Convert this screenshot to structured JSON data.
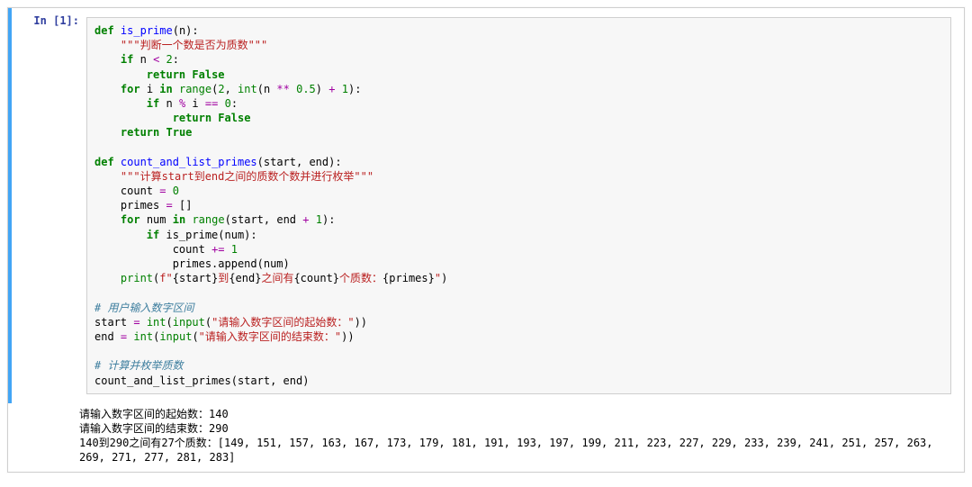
{
  "cell": {
    "prompt": "In [1]:",
    "code": {
      "l01": {
        "def": "def",
        "fn": "is_prime",
        "rest": "(n):"
      },
      "l02": {
        "doc": "\"\"\"判断一个数是否为质数\"\"\""
      },
      "l03": {
        "kw_if": "if",
        "n": "n",
        "lt": "<",
        "two": "2",
        "colon": ":"
      },
      "l04": {
        "ret": "return",
        "false": "False"
      },
      "l05": {
        "for": "for",
        "i": "i",
        "in": "in",
        "range": "range",
        "two": "2",
        "int": "int",
        "n": "n",
        "star": "**",
        "half": "0.5",
        "plus": "+",
        "one": "1",
        "colon": ":"
      },
      "l06": {
        "if": "if",
        "n": "n",
        "mod": "%",
        "i": "i",
        "eq": "==",
        "zero": "0",
        "colon": ":"
      },
      "l07": {
        "ret": "return",
        "false": "False"
      },
      "l08": {
        "ret": "return",
        "true": "True"
      },
      "l09": {
        "def": "def",
        "fn": "count_and_list_primes",
        "rest": "(start, end):"
      },
      "l10": {
        "doc": "\"\"\"计算start到end之间的质数个数并进行枚举\"\"\""
      },
      "l11": {
        "count": "count",
        "eq": "=",
        "zero": "0"
      },
      "l12": {
        "primes": "primes",
        "eq": "=",
        "br": "[]"
      },
      "l13": {
        "for": "for",
        "num": "num",
        "in": "in",
        "range": "range",
        "args": "(start, end ",
        "plus": "+",
        "one": "1",
        "colon": "):"
      },
      "l14": {
        "if": "if",
        "call": "is_prime(num):"
      },
      "l15": {
        "count": "count",
        "pluseq": "+=",
        "one": "1"
      },
      "l16": {
        "line": "primes.append(num)"
      },
      "l17": {
        "print": "print",
        "f": "f\"",
        "s1": "{start}",
        "t1": "到",
        "s2": "{end}",
        "t2": "之间有",
        "s3": "{count}",
        "t3": "个质数：",
        "s4": "{primes}",
        "end": "\""
      },
      "l18": {
        "cmt": "# 用户输入数字区间"
      },
      "l19": {
        "start": "start",
        "eq": "=",
        "int": "int",
        "input": "input",
        "str": "\"请输入数字区间的起始数：\""
      },
      "l20": {
        "end": "end",
        "eq": "=",
        "int": "int",
        "input": "input",
        "str": "\"请输入数字区间的结束数：\""
      },
      "l21": {
        "cmt": "# 计算并枚举质数"
      },
      "l22": {
        "line": "count_and_list_primes(start, end)"
      }
    },
    "output_lines": {
      "o1": "请输入数字区间的起始数：140",
      "o2": "请输入数字区间的结束数：290",
      "o3": "140到290之间有27个质数：[149, 151, 157, 163, 167, 173, 179, 181, 191, 193, 197, 199, 211, 223, 227, 229, 233, 239, 241, 251, 257, 263, 269, 271, 277, 281, 283]"
    }
  },
  "chart_data": {
    "type": "table",
    "title": "Primes between 140 and 290",
    "values": [
      149,
      151,
      157,
      163,
      167,
      173,
      179,
      181,
      191,
      193,
      197,
      199,
      211,
      223,
      227,
      229,
      233,
      239,
      241,
      251,
      257,
      263,
      269,
      271,
      277,
      281,
      283
    ],
    "count": 27,
    "range_start": 140,
    "range_end": 290
  }
}
